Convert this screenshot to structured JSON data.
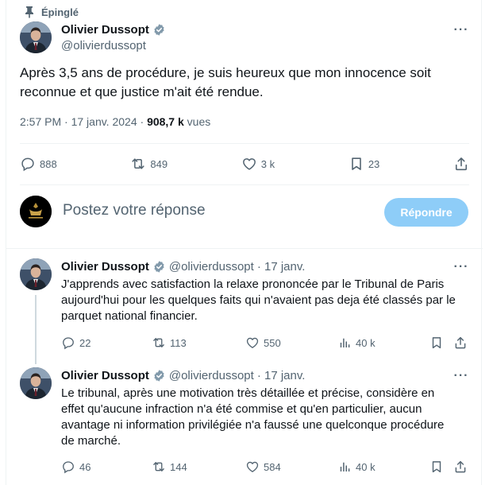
{
  "main_tweet": {
    "pinned_label": "Épinglé",
    "author_name": "Olivier Dussopt",
    "author_handle": "@olivierdussopt",
    "text_line1": "Après 3,5 ans de procédure, je suis heureux que mon innocence soit",
    "text_line2": "reconnue et que justice m'ait été rendue.",
    "time": "2:57 PM · 17 janv. 2024 · ",
    "views_count": "908,7 k",
    "views_label": " vues",
    "replies": "888",
    "reposts": "849",
    "likes": "3 k",
    "bookmarks": "23"
  },
  "reply_composer": {
    "placeholder": "Postez votre réponse",
    "button_label": "Répondre"
  },
  "replies": [
    {
      "author_name": "Olivier Dussopt",
      "author_handle": "@olivierdussopt",
      "date": "· 17 janv.",
      "lines": [
        "J'apprends avec satisfaction la relaxe prononcée par le Tribunal de Paris",
        "aujourd'hui pour les quelques faits qui n'avaient pas deja été classés par le",
        "parquet national financier."
      ],
      "replies": "22",
      "reposts": "113",
      "likes": "550",
      "views": "40 k"
    },
    {
      "author_name": "Olivier Dussopt",
      "author_handle": "@olivierdussopt",
      "date": "· 17 janv.",
      "lines": [
        "Le tribunal, après une motivation très détaillée et précise, considère en",
        "effet qu'aucune infraction n'a été commise et qu'en particulier, aucun",
        "avantage ni information privilégiée n'a faussé une quelconque procédure",
        "de marché."
      ],
      "replies": "46",
      "reposts": "144",
      "likes": "584",
      "views": "40 k"
    }
  ],
  "colors": {
    "accent": "#1d9bf0",
    "button_disabled": "#8ecdf8",
    "secondary_text": "#536471",
    "primary_text": "#0f1419",
    "divider": "#eff3f4"
  },
  "icons": [
    "pin-icon",
    "verified-icon",
    "more-icon",
    "reply-icon",
    "repost-icon",
    "like-icon",
    "bookmark-icon",
    "share-icon",
    "views-icon"
  ]
}
